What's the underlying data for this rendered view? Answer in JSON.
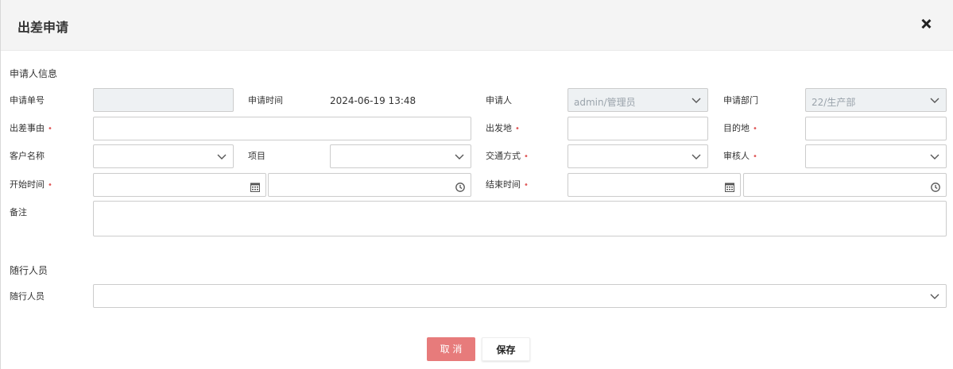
{
  "dialog": {
    "title": "出差申请",
    "close_icon": "close-icon"
  },
  "applicant_section": {
    "title": "申请人信息"
  },
  "fields": {
    "apply_no": {
      "label": "申请单号",
      "value": ""
    },
    "apply_time": {
      "label": "申请时间",
      "value": "2024-06-19 13:48"
    },
    "applicant": {
      "label": "申请人",
      "value": "admin/管理员"
    },
    "department": {
      "label": "申请部门",
      "value": "22/生产部"
    },
    "reason": {
      "label": "出差事由",
      "required": "•",
      "value": ""
    },
    "departure": {
      "label": "出发地",
      "required": "•",
      "value": ""
    },
    "destination": {
      "label": "目的地",
      "required": "•",
      "value": ""
    },
    "customer": {
      "label": "客户名称",
      "value": ""
    },
    "project": {
      "label": "项目",
      "value": ""
    },
    "transport": {
      "label": "交通方式",
      "required": "•",
      "value": ""
    },
    "reviewer": {
      "label": "审核人",
      "required": "•",
      "value": ""
    },
    "start_time": {
      "label": "开始时间",
      "required": "•",
      "date": "",
      "time": ""
    },
    "end_time": {
      "label": "结束时间",
      "required": "•",
      "date": "",
      "time": ""
    },
    "remark": {
      "label": "备注",
      "value": ""
    }
  },
  "companion_section": {
    "title": "随行人员"
  },
  "companions": {
    "label": "随行人员",
    "value": ""
  },
  "buttons": {
    "cancel": "取 消",
    "save": "保存"
  },
  "colors": {
    "header_bg": "#f4f4f4",
    "cancel_bg": "#e77b7b",
    "required_mark": "#e05a5a",
    "disabled_bg": "#eef1f3"
  }
}
